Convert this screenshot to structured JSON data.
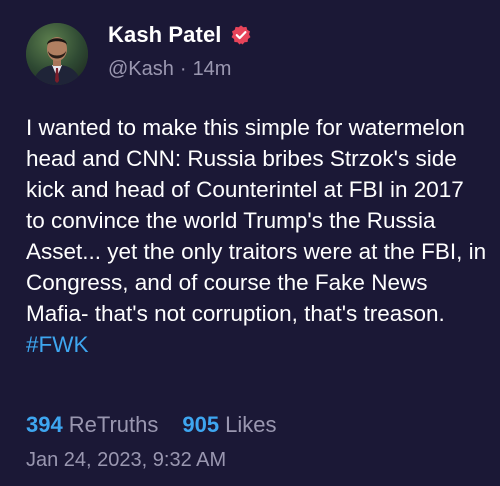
{
  "author": {
    "display_name": "Kash Patel",
    "handle": "@Kash",
    "separator": "·",
    "relative_time": "14m",
    "avatar_icon": "profile-photo",
    "verified_icon": "verified-badge-icon"
  },
  "post": {
    "text": "I wanted to make this simple for watermelon head and CNN: Russia bribes Strzok's side kick and head of Counterintel at FBI in 2017 to convince the world Trump's the Russia Asset... yet the only traitors were at the FBI, in Congress, and of course the Fake News Mafia- that's not corruption, that's treason. ",
    "hashtag": "#FWK"
  },
  "stats": {
    "retruths_count": "394",
    "retruths_label": "ReTruths",
    "likes_count": "905",
    "likes_label": "Likes"
  },
  "timestamp": "Jan 24, 2023, 9:32 AM",
  "colors": {
    "background": "#1b1836",
    "accent": "#3ea6f0",
    "muted": "#9a97b0",
    "verified": "#e8445a"
  }
}
